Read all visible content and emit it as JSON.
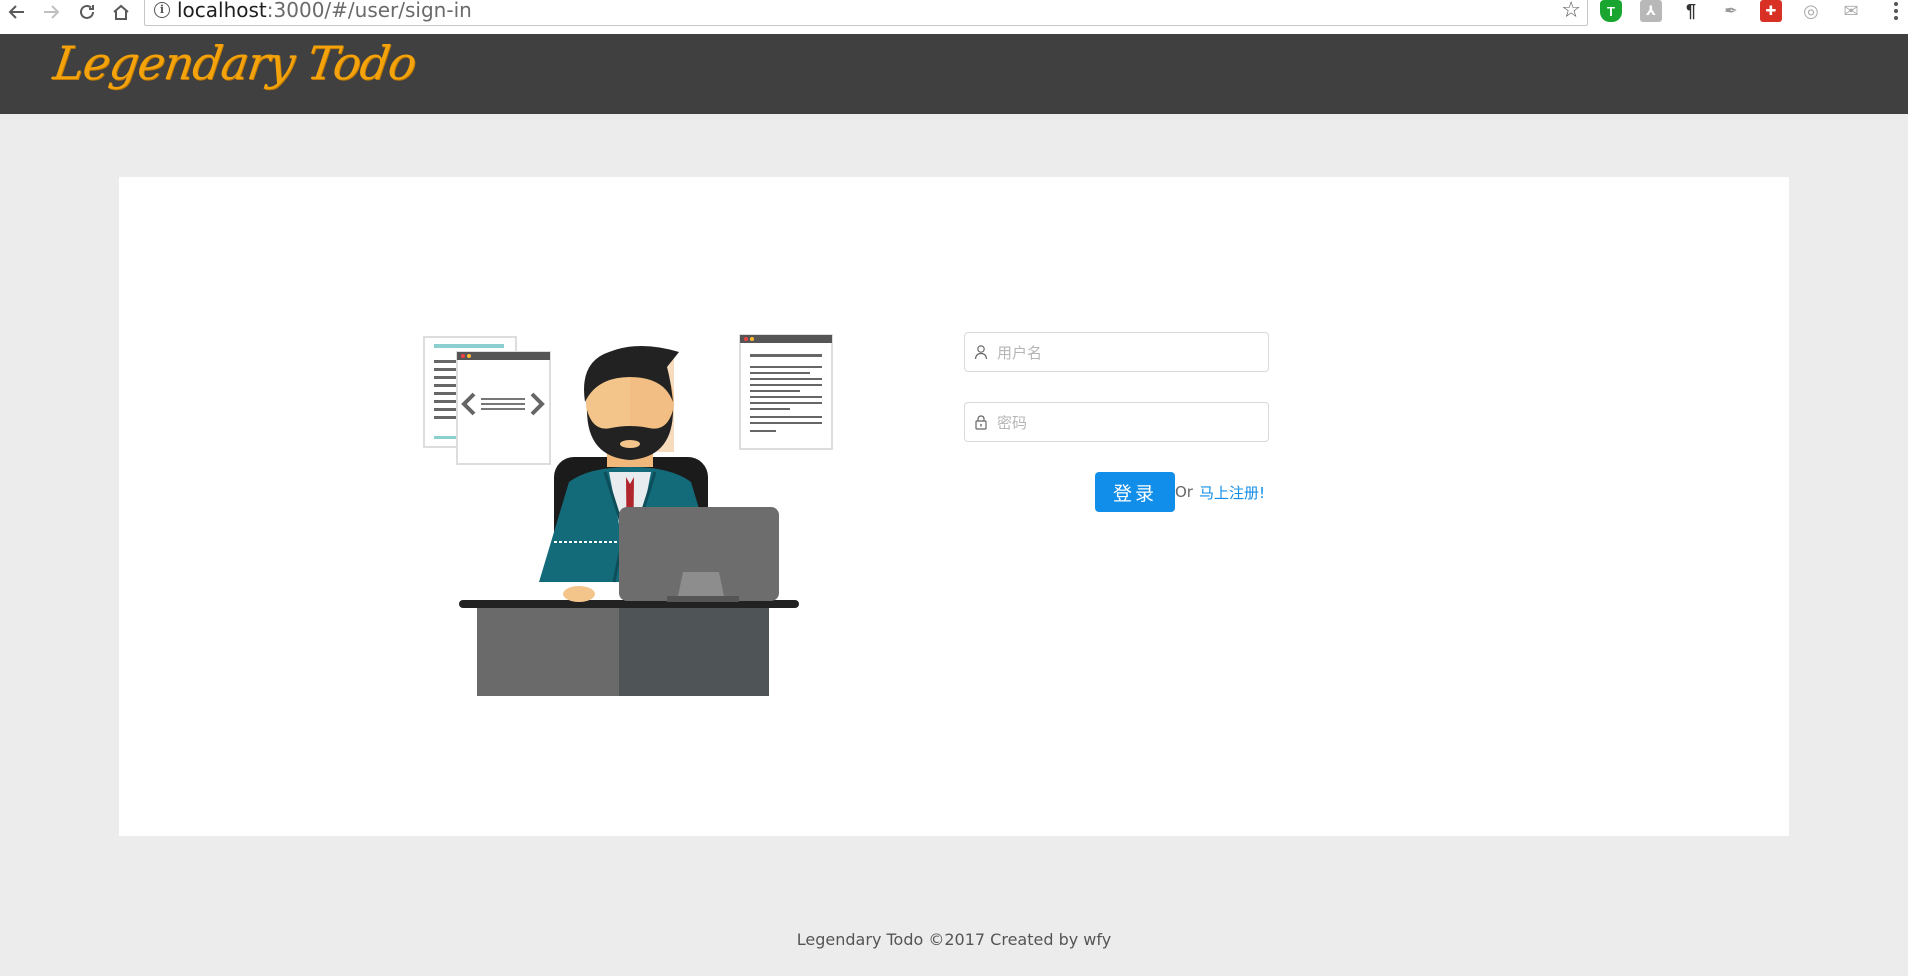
{
  "browser": {
    "url_host": "localhost",
    "url_rest": ":3000/#/user/sign-in",
    "extensions": [
      {
        "name": "shield-extension-icon",
        "color": "#1aa530",
        "glyph": "T"
      },
      {
        "name": "pdf-extension-icon",
        "color": "#b0b0b0",
        "glyph": "入"
      },
      {
        "name": "paragraph-extension-icon",
        "color": "#ffffff",
        "glyph": "¶"
      },
      {
        "name": "feather-extension-icon",
        "color": "#ffffff",
        "glyph": "✒"
      },
      {
        "name": "red-extension-icon",
        "color": "#d93025",
        "glyph": "✚"
      },
      {
        "name": "circle-extension-icon",
        "color": "#ffffff",
        "glyph": "◎"
      },
      {
        "name": "mail-extension-icon",
        "color": "#ffffff",
        "glyph": "✉"
      }
    ]
  },
  "header": {
    "logo_text": "Legendary Todo"
  },
  "login": {
    "username_placeholder": "用户名",
    "password_placeholder": "密码",
    "login_label": "登录",
    "or_text": "Or",
    "register_label": "马上注册!"
  },
  "footer": {
    "text": "Legendary Todo ©2017 Created by wfy"
  },
  "colors": {
    "header_bg": "#404040",
    "logo": "#f5a30a",
    "primary": "#108ee9",
    "page_bg": "#ececec"
  }
}
